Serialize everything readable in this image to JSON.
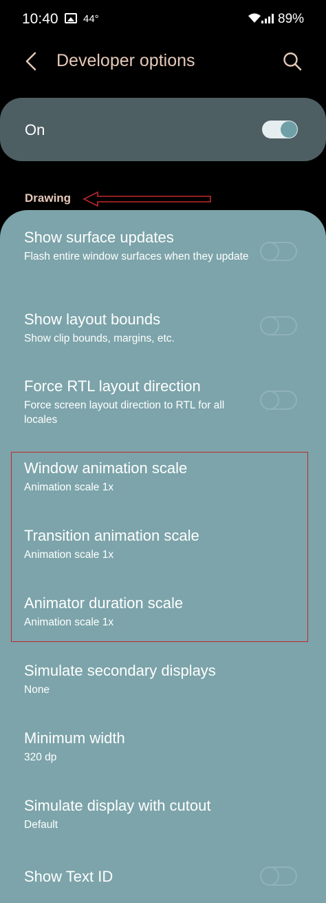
{
  "status_bar": {
    "time": "10:40",
    "temperature": "44°",
    "battery": "89%"
  },
  "header": {
    "title": "Developer options"
  },
  "master_switch": {
    "label": "On",
    "enabled": true
  },
  "section": {
    "title": "Drawing"
  },
  "items": [
    {
      "title": "Show surface updates",
      "subtitle": "Flash entire window surfaces when they update",
      "toggle": false
    },
    {
      "title": "Show layout bounds",
      "subtitle": "Show clip bounds, margins, etc.",
      "toggle": false
    },
    {
      "title": "Force RTL layout direction",
      "subtitle": "Force screen layout direction to RTL for all locales",
      "toggle": false
    },
    {
      "title": "Window animation scale",
      "subtitle": "Animation scale 1x"
    },
    {
      "title": "Transition animation scale",
      "subtitle": "Animation scale 1x"
    },
    {
      "title": "Animator duration scale",
      "subtitle": "Animation scale 1x"
    },
    {
      "title": "Simulate secondary displays",
      "subtitle": "None"
    },
    {
      "title": "Minimum width",
      "subtitle": "320 dp"
    },
    {
      "title": "Simulate display with cutout",
      "subtitle": "Default"
    },
    {
      "title": "Show Text ID",
      "toggle": false
    }
  ],
  "colors": {
    "accent": "#e6c9b8",
    "panel": "#7ca4aa",
    "annotation": "#c0282d"
  }
}
